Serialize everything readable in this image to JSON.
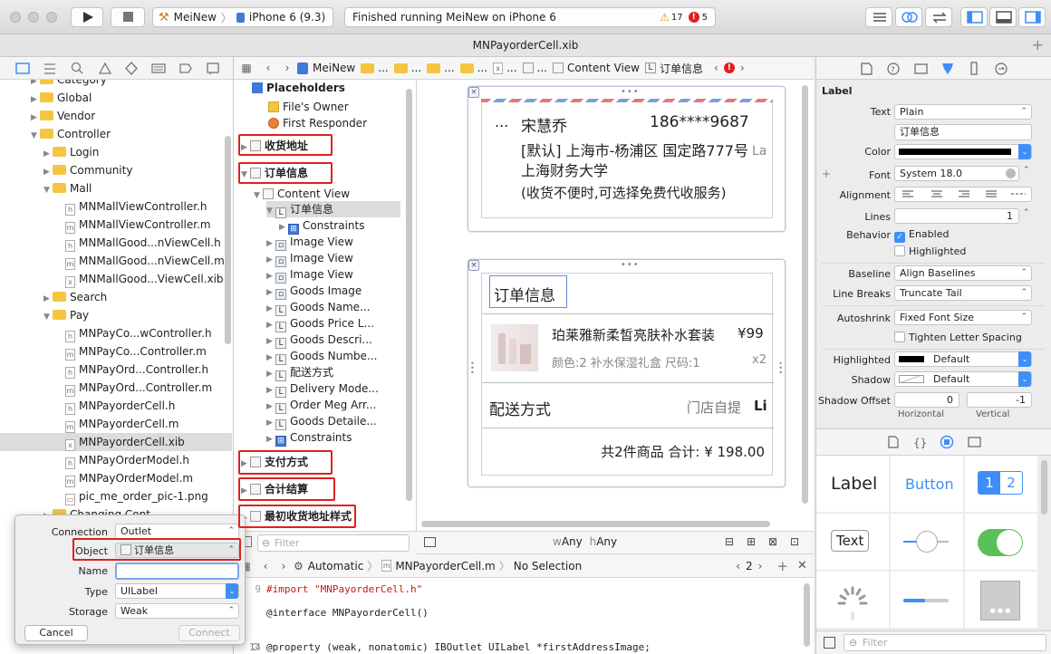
{
  "toolbar": {
    "scheme": "MeiNew",
    "device": "iPhone 6 (9.3)",
    "status": "Finished running MeiNew on iPhone 6",
    "warnings": "17",
    "errors": "5"
  },
  "title": "MNPayorderCell.xib",
  "navigator": {
    "items": [
      {
        "label": "Category",
        "indent": 1,
        "kind": "folder"
      },
      {
        "label": "Global",
        "indent": 1,
        "kind": "folder"
      },
      {
        "label": "Vendor",
        "indent": 1,
        "kind": "folder"
      },
      {
        "label": "Controller",
        "indent": 1,
        "kind": "folder",
        "open": true
      },
      {
        "label": "Login",
        "indent": 2,
        "kind": "folder"
      },
      {
        "label": "Community",
        "indent": 2,
        "kind": "folder"
      },
      {
        "label": "Mall",
        "indent": 2,
        "kind": "folder",
        "open": true
      },
      {
        "label": "MNMallViewController.h",
        "indent": 3,
        "kind": "h"
      },
      {
        "label": "MNMallViewController.m",
        "indent": 3,
        "kind": "m"
      },
      {
        "label": "MNMallGood...nViewCell.h",
        "indent": 3,
        "kind": "h"
      },
      {
        "label": "MNMallGood...nViewCell.m",
        "indent": 3,
        "kind": "m"
      },
      {
        "label": "MNMallGood...ViewCell.xib",
        "indent": 3,
        "kind": "x"
      },
      {
        "label": "Search",
        "indent": 2,
        "kind": "folder"
      },
      {
        "label": "Pay",
        "indent": 2,
        "kind": "folder",
        "open": true
      },
      {
        "label": "MNPayCo...wController.h",
        "indent": 3,
        "kind": "h"
      },
      {
        "label": "MNPayCo...Controller.m",
        "indent": 3,
        "kind": "m"
      },
      {
        "label": "MNPayOrd...Controller.h",
        "indent": 3,
        "kind": "h"
      },
      {
        "label": "MNPayOrd...Controller.m",
        "indent": 3,
        "kind": "m"
      },
      {
        "label": "MNPayorderCell.h",
        "indent": 3,
        "kind": "h"
      },
      {
        "label": "MNPayorderCell.m",
        "indent": 3,
        "kind": "m"
      },
      {
        "label": "MNPayorderCell.xib",
        "indent": 3,
        "kind": "x",
        "selected": true
      },
      {
        "label": "MNPayOrderModel.h",
        "indent": 3,
        "kind": "h"
      },
      {
        "label": "MNPayOrderModel.m",
        "indent": 3,
        "kind": "m"
      },
      {
        "label": "pic_me_order_pic-1.png",
        "indent": 3,
        "kind": "p"
      },
      {
        "label": "Changing Cont...",
        "indent": 2,
        "kind": "folder"
      }
    ]
  },
  "jumpbar": {
    "project": "MeiNew",
    "ellipsis": "...",
    "content_view": "Content View",
    "selected": "订单信息"
  },
  "outline": {
    "placeholders": "Placeholders",
    "files_owner": "File's Owner",
    "first_responder": "First Responder",
    "rows": [
      {
        "label": "收货地址",
        "indent": 0,
        "icon": "view",
        "bold": true
      },
      {
        "label": "订单信息",
        "indent": 0,
        "icon": "view",
        "bold": true
      },
      {
        "label": "Content View",
        "indent": 1,
        "icon": "view"
      },
      {
        "label": "订单信息",
        "indent": 2,
        "icon": "L",
        "selected": true
      },
      {
        "label": "Constraints",
        "indent": 3,
        "icon": "constraint"
      },
      {
        "label": "Image View",
        "indent": 2,
        "icon": "img"
      },
      {
        "label": "Image View",
        "indent": 2,
        "icon": "img"
      },
      {
        "label": "Image View",
        "indent": 2,
        "icon": "img"
      },
      {
        "label": "Goods Image",
        "indent": 2,
        "icon": "img"
      },
      {
        "label": "Goods Name...",
        "indent": 2,
        "icon": "L"
      },
      {
        "label": "Goods Price L...",
        "indent": 2,
        "icon": "L"
      },
      {
        "label": "Goods Descri...",
        "indent": 2,
        "icon": "L"
      },
      {
        "label": "Goods Numbe...",
        "indent": 2,
        "icon": "L"
      },
      {
        "label": "配送方式",
        "indent": 2,
        "icon": "L"
      },
      {
        "label": "Delivery Mode...",
        "indent": 2,
        "icon": "L"
      },
      {
        "label": "Order Meg Arr...",
        "indent": 2,
        "icon": "L"
      },
      {
        "label": "Goods Detaile...",
        "indent": 2,
        "icon": "L"
      },
      {
        "label": "Constraints",
        "indent": 2,
        "icon": "constraint"
      },
      {
        "label": "支付方式",
        "indent": 0,
        "icon": "view",
        "bold": true
      },
      {
        "label": "合计结算",
        "indent": 0,
        "icon": "view",
        "bold": true
      },
      {
        "label": "最初收货地址样式",
        "indent": 0,
        "icon": "view",
        "bold": true
      }
    ],
    "filter_placeholder": "Filter"
  },
  "canvas": {
    "address": {
      "ellipsis": "...",
      "name": "宋慧乔",
      "phone": "186****9687",
      "line1": "[默认] 上海市-杨浦区 国定路777号",
      "line2": "上海财务大学",
      "line3": "(收货不便时,可选择免费代收服务)",
      "trail": "La"
    },
    "order": {
      "title": "订单信息",
      "goods_name": "珀莱雅新柔皙亮肤补水套装",
      "price": "¥99",
      "desc": "颜色:2 补水保湿礼盒 尺码:1",
      "qty": "x2",
      "delivery_label": "配送方式",
      "delivery_value": "门店自提",
      "delivery_trail": "Li",
      "summary": "共2件商品 合计: ¥ 198.00"
    },
    "size_w": "w",
    "size_w_val": "Any",
    "size_h": "h",
    "size_h_val": "Any"
  },
  "assistant": {
    "mode": "Automatic",
    "file": "MNPayorderCell.m",
    "selection": "No Selection",
    "count": "2"
  },
  "code": [
    {
      "ln": "9",
      "text": "#import \"MNPayorderCell.h\"",
      "color": "#c41a16"
    },
    {
      "ln": "",
      "text": "",
      "color": "#222"
    },
    {
      "ln": "",
      "text": "@interface MNPayorderCell()",
      "color": "#222"
    },
    {
      "ln": "",
      "text": "",
      "color": "#222"
    },
    {
      "ln": "14",
      "text": "@property (weak, nonatomic) IBOutlet UILabel *firstAddressImage;",
      "color": "#222"
    }
  ],
  "inspector": {
    "section": "Label",
    "text_label": "Text",
    "text_value": "Plain",
    "text_content": "订单信息",
    "color_label": "Color",
    "font_label": "Font",
    "font_value": "System 18.0",
    "alignment_label": "Alignment",
    "lines_label": "Lines",
    "lines_value": "1",
    "behavior_label": "Behavior",
    "enabled": "Enabled",
    "highlighted_cb": "Highlighted",
    "baseline_label": "Baseline",
    "baseline_value": "Align Baselines",
    "linebreaks_label": "Line Breaks",
    "linebreaks_value": "Truncate Tail",
    "autoshrink_label": "Autoshrink",
    "autoshrink_value": "Fixed Font Size",
    "tighten": "Tighten Letter Spacing",
    "highlighted_label": "Highlighted",
    "highlighted_value": "Default",
    "shadow_label": "Shadow",
    "shadow_value": "Default",
    "shadow_offset_label": "Shadow Offset",
    "shadow_h": "0",
    "shadow_v": "-1",
    "horizontal": "Horizontal",
    "vertical": "Vertical"
  },
  "library": {
    "label": "Label",
    "button": "Button",
    "seg1": "1",
    "seg2": "2",
    "text": "Text",
    "filter_placeholder": "Filter"
  },
  "popover": {
    "connection_label": "Connection",
    "connection_value": "Outlet",
    "object_label": "Object",
    "object_value": "订单信息",
    "name_label": "Name",
    "name_value": "",
    "type_label": "Type",
    "type_value": "UILabel",
    "storage_label": "Storage",
    "storage_value": "Weak",
    "cancel": "Cancel",
    "connect": "Connect"
  },
  "colors": {
    "accent": "#3f8ef7",
    "highlight": "#e02020",
    "selection": "#dcdcdc"
  }
}
